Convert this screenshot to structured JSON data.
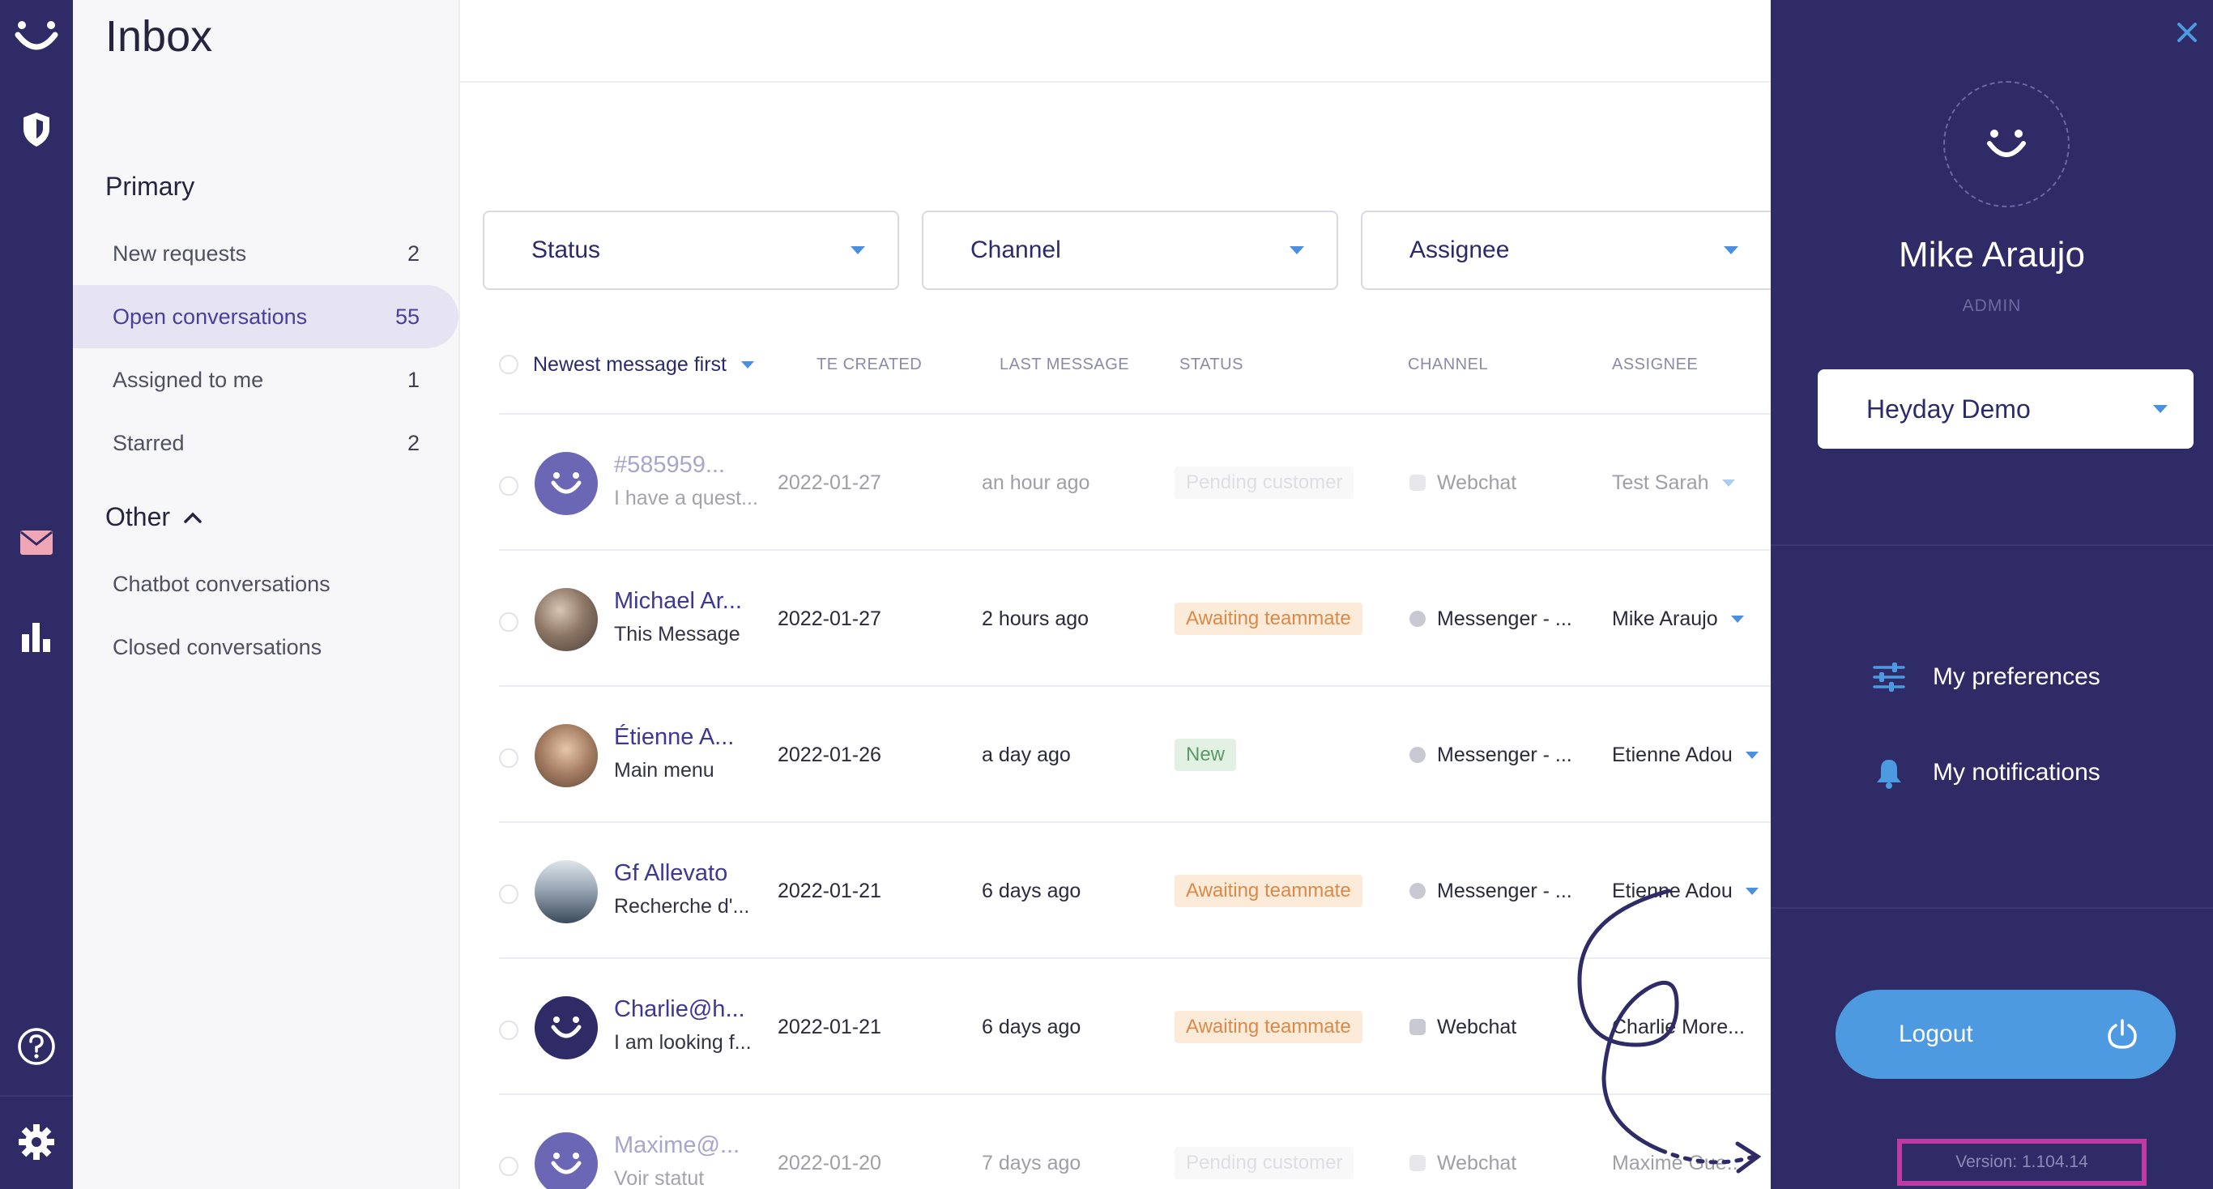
{
  "rail": {
    "icons": [
      "smiley-logo-icon",
      "shield-icon",
      "mail-icon",
      "bar-chart-icon",
      "help-icon",
      "gear-icon"
    ]
  },
  "nav": {
    "title": "Inbox",
    "primary_label": "Primary",
    "items": [
      {
        "label": "New requests",
        "count": "2"
      },
      {
        "label": "Open conversations",
        "count": "55"
      },
      {
        "label": "Assigned to me",
        "count": "1"
      },
      {
        "label": "Starred",
        "count": "2"
      }
    ],
    "other_label": "Other",
    "other_items": [
      {
        "label": "Chatbot conversations"
      },
      {
        "label": "Closed conversations"
      }
    ]
  },
  "filters": [
    {
      "label": "Status"
    },
    {
      "label": "Channel"
    },
    {
      "label": "Assignee"
    }
  ],
  "table": {
    "sort_label": "Newest message first",
    "headers": {
      "created": "TE CREATED",
      "last_message": "LAST MESSAGE",
      "status": "STATUS",
      "channel": "CHANNEL",
      "assignee": "ASSIGNEE"
    },
    "rows": [
      {
        "name": "#585959...",
        "preview": "I have a quest...",
        "date": "2022-01-27",
        "last": "an hour ago",
        "status": "Pending customer",
        "channel": "Webchat",
        "assignee": "Test Sarah"
      },
      {
        "name": "Michael Ar...",
        "preview": "This Message",
        "date": "2022-01-27",
        "last": "2 hours ago",
        "status": "Awaiting teammate",
        "channel": "Messenger - ...",
        "assignee": "Mike Araujo"
      },
      {
        "name": "Étienne A...",
        "preview": "Main menu",
        "date": "2022-01-26",
        "last": "a day ago",
        "status": "New",
        "channel": "Messenger - ...",
        "assignee": "Etienne Adou"
      },
      {
        "name": "Gf Allevato",
        "preview": "Recherche d'...",
        "date": "2022-01-21",
        "last": "6 days ago",
        "status": "Awaiting teammate",
        "channel": "Messenger - ...",
        "assignee": "Etienne Adou"
      },
      {
        "name": "Charlie@h...",
        "preview": "I am looking f...",
        "date": "2022-01-21",
        "last": "6 days ago",
        "status": "Awaiting teammate",
        "channel": "Webchat",
        "assignee": "Charlie More..."
      },
      {
        "name": "Maxime@...",
        "preview": "Voir statut",
        "date": "2022-01-20",
        "last": "7 days ago",
        "status": "Pending customer",
        "channel": "Webchat",
        "assignee": "Maxime Gue..."
      }
    ]
  },
  "panel": {
    "user_name": "Mike Araujo",
    "role": "ADMIN",
    "workspace": "Heyday Demo",
    "preferences_label": "My preferences",
    "notifications_label": "My notifications",
    "logout_label": "Logout",
    "version": "Version: 1.104.14"
  },
  "colors": {
    "rail": "#2e2b66",
    "accent": "#4a8fe0",
    "brand_text": "#3d3894",
    "highlight": "#c03aa6"
  }
}
